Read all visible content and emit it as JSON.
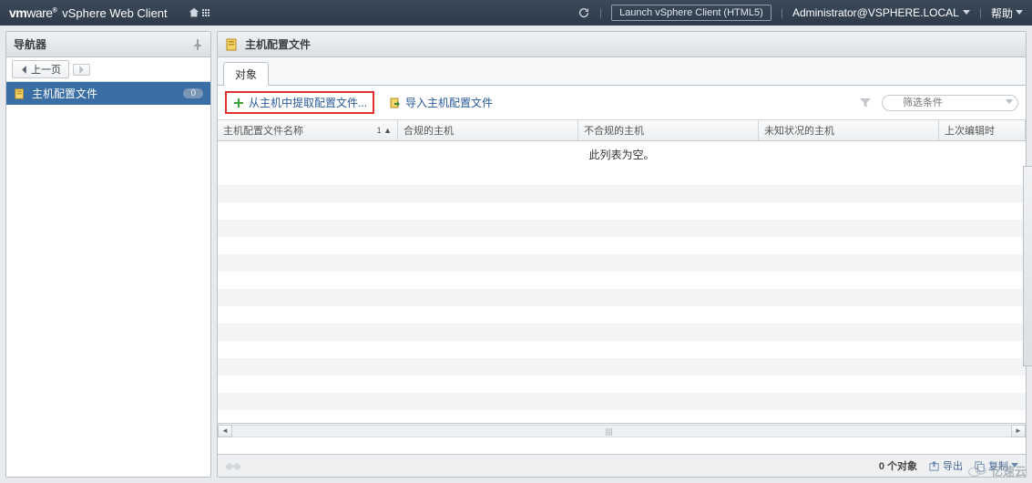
{
  "header": {
    "logo_bold": "vm",
    "logo_thin": "ware",
    "product": "vSphere Web Client",
    "launch_label": "Launch vSphere Client (HTML5)",
    "user": "Administrator@VSPHERE.LOCAL",
    "help": "帮助"
  },
  "navigator": {
    "title": "导航器",
    "back_label": "上一页",
    "item_label": "主机配置文件",
    "item_badge": "0"
  },
  "content": {
    "title": "主机配置文件",
    "tab": "对象",
    "action_extract": "从主机中提取配置文件...",
    "action_import": "导入主机配置文件",
    "filter_placeholder": "筛选条件",
    "columns": {
      "name": "主机配置文件名称",
      "sort_indicator": "1 ▲",
      "compliant": "合规的主机",
      "noncompliant": "不合规的主机",
      "unknown": "未知状况的主机",
      "last": "上次编辑时"
    },
    "empty_message": "此列表为空。",
    "footer": {
      "object_count": "0 个对象",
      "export": "导出",
      "copy": "复制"
    }
  },
  "watermark": "亿速云"
}
